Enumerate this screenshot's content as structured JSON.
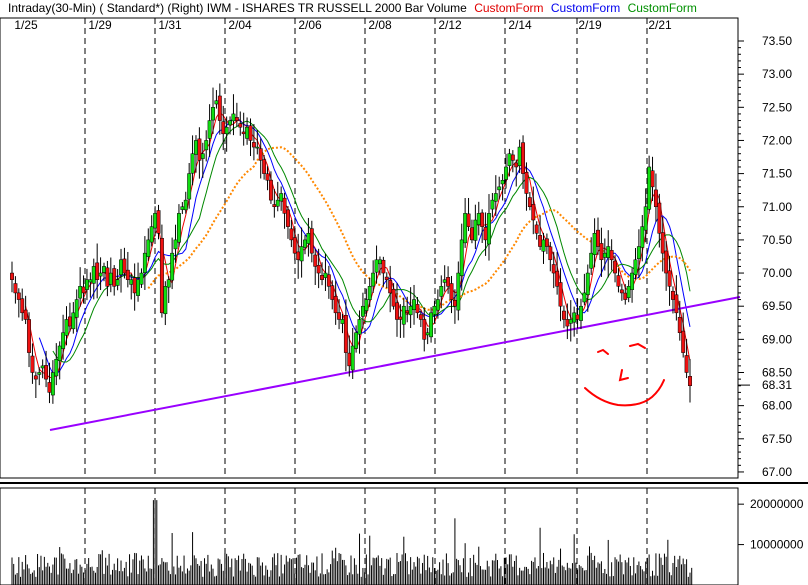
{
  "header": {
    "title": "Intraday(30-Min) ( Standard*)   (Right)  IWM - ISHARES TR RUSSELL 2000  Bar  Volume",
    "custom_forms": [
      {
        "label": "CustomForm",
        "color": "#e00000"
      },
      {
        "label": "CustomForm",
        "color": "#0000ee"
      },
      {
        "label": "CustomForm",
        "color": "#009000"
      }
    ]
  },
  "colors": {
    "up": "#11dd11",
    "down": "#ee1111",
    "ma_red": "#ee0000",
    "ma_blue": "#0000ff",
    "ma_green": "#008800",
    "ma_orange": "#ff8800",
    "trendline": "#9900ff",
    "drawing": "#ff0000",
    "volume": "#000000"
  },
  "chart_data": [
    {
      "type": "candlestick",
      "title": "",
      "x_ticks": [
        "1/25",
        "1/29",
        "1/31",
        "2/04",
        "2/06",
        "2/08",
        "2/12",
        "2/14",
        "2/19",
        "2/21"
      ],
      "y_ticks": [
        "73.50",
        "73.00",
        "72.50",
        "72.00",
        "71.50",
        "71.00",
        "70.50",
        "70.00",
        "69.50",
        "69.00",
        "68.50",
        "68.00",
        "67.50",
        "67.00"
      ],
      "ylim": [
        67.0,
        73.7
      ],
      "last_price": "68.31",
      "grid": false,
      "closes": [
        69.9,
        69.7,
        69.6,
        69.4,
        69.3,
        68.8,
        68.5,
        68.4,
        68.5,
        68.6,
        68.4,
        68.2,
        68.5,
        68.7,
        68.9,
        69.1,
        69.3,
        69.2,
        69.4,
        69.6,
        69.8,
        69.7,
        69.9,
        69.9,
        70.1,
        69.9,
        70.0,
        70.1,
        69.8,
        70.0,
        69.8,
        69.9,
        70.2,
        70.0,
        69.9,
        69.9,
        69.7,
        69.9,
        70.0,
        70.3,
        70.5,
        70.7,
        70.9,
        70.6,
        69.4,
        69.8,
        69.9,
        70.3,
        70.5,
        70.9,
        71.0,
        71.1,
        71.5,
        71.8,
        72.0,
        71.7,
        71.8,
        72.0,
        72.3,
        72.5,
        72.6,
        72.3,
        72.1,
        72.2,
        72.3,
        72.4,
        72.3,
        72.2,
        72.1,
        72.2,
        72.0,
        71.9,
        71.9,
        71.7,
        71.5,
        71.4,
        71.1,
        71.0,
        71.1,
        71.2,
        70.9,
        70.7,
        70.5,
        70.3,
        70.2,
        70.4,
        70.5,
        70.6,
        70.3,
        70.1,
        70.0,
        69.9,
        70.0,
        69.8,
        69.6,
        69.4,
        69.3,
        69.3,
        68.8,
        68.6,
        68.9,
        69.1,
        69.3,
        69.5,
        69.6,
        69.8,
        70.0,
        70.2,
        70.2,
        70.0,
        69.9,
        69.7,
        69.5,
        69.3,
        69.3,
        69.5,
        69.4,
        69.5,
        69.6,
        69.4,
        69.3,
        69.0,
        69.1,
        69.4,
        69.5,
        69.6,
        69.8,
        69.9,
        69.8,
        69.6,
        69.5,
        70.0,
        70.5,
        70.9,
        70.7,
        70.5,
        70.8,
        70.9,
        70.7,
        70.5,
        70.9,
        71.1,
        71.2,
        71.3,
        71.4,
        71.6,
        71.8,
        71.7,
        71.6,
        71.9,
        71.5,
        71.2,
        71.0,
        70.8,
        70.6,
        70.4,
        70.5,
        70.4,
        70.2,
        70.0,
        69.8,
        69.5,
        69.3,
        69.2,
        69.3,
        69.4,
        69.3,
        69.5,
        69.7,
        70.0,
        70.3,
        70.6,
        70.4,
        70.2,
        70.3,
        70.4,
        70.2,
        70.0,
        69.8,
        69.7,
        69.6,
        69.8,
        70.0,
        70.2,
        70.4,
        70.7,
        71.0,
        71.6,
        71.3,
        71.0,
        70.6,
        70.3,
        70.0,
        69.8,
        69.6,
        69.4,
        69.1,
        68.8,
        68.5,
        68.3
      ]
    },
    {
      "type": "bar",
      "title": "Volume",
      "y_ticks": [
        "20000000",
        "10000000"
      ],
      "ylim": [
        0,
        24000000
      ]
    }
  ]
}
